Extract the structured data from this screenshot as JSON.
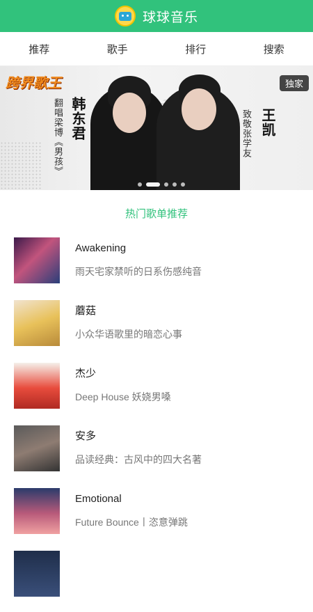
{
  "header": {
    "title": "球球音乐",
    "logo_icon": "tv-mascot-icon",
    "bg_color": "#31c27c"
  },
  "nav": {
    "tabs": [
      "推荐",
      "歌手",
      "排行",
      "搜索"
    ]
  },
  "banner": {
    "logo_text": "跨界歌王",
    "badge": "独家",
    "left_name": "韩东君",
    "left_subtitle": "翻唱梁博《男孩》",
    "right_name": "王凯",
    "right_subtitle": "致敬张学友",
    "dot_count": 5,
    "active_dot": 1
  },
  "section": {
    "title": "热门歌单推荐",
    "accent_color": "#31c27c"
  },
  "playlists": [
    {
      "name": "Awakening",
      "desc": "雨天宅家禁听的日系伤感纯音"
    },
    {
      "name": "蘑菇",
      "desc": "小众华语歌里的暗恋心事"
    },
    {
      "name": "杰少",
      "desc": "Deep House 妖娆男嗓"
    },
    {
      "name": "安多",
      "desc": "品读经典：古风中的四大名著"
    },
    {
      "name": "Emotional",
      "desc": "Future Bounce丨恣意弹跳"
    }
  ]
}
